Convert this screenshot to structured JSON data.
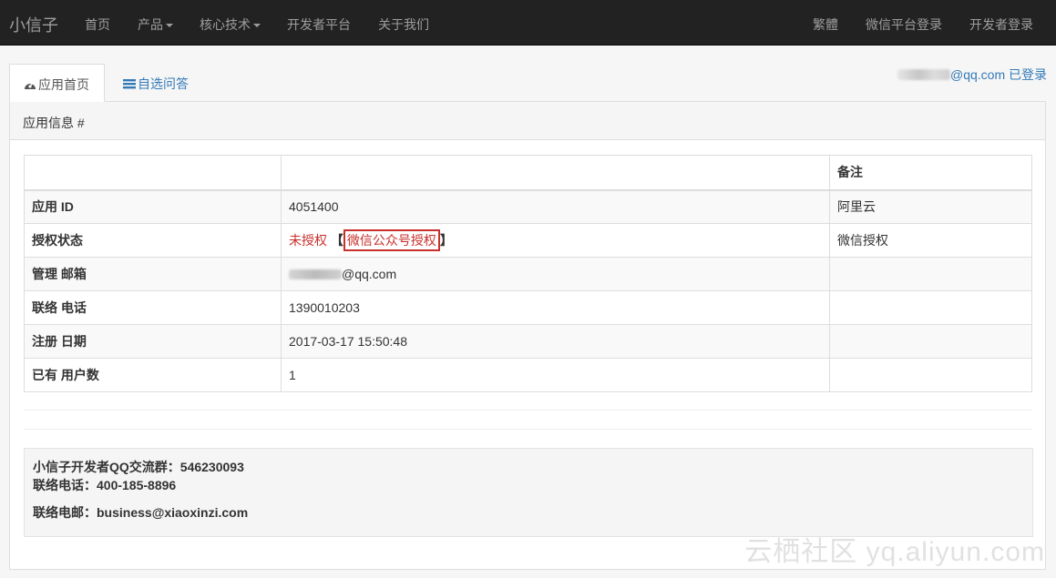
{
  "navbar": {
    "brand": "小信子",
    "items": [
      "首页",
      "产品",
      "核心技术",
      "开发者平台",
      "关于我们"
    ],
    "right_items": [
      "繁體",
      "微信平台登录",
      "开发者登录"
    ]
  },
  "tabs": [
    {
      "label": "应用首页",
      "icon": "dashboard-icon"
    },
    {
      "label": "自选问答",
      "icon": "list-icon"
    }
  ],
  "login_status": {
    "email_suffix": "@qq.com",
    "text": " 已登录"
  },
  "panel": {
    "title": "应用信息 #"
  },
  "table": {
    "header_note": "备注",
    "rows": [
      {
        "label": "应用 ID",
        "value": "4051400",
        "note": "阿里云"
      },
      {
        "label": "授权状态",
        "status": "未授权",
        "bracket_open": "【",
        "link": "微信公众号授权",
        "bracket_close": "】",
        "note": "微信授权"
      },
      {
        "label": "管理 邮箱",
        "email_suffix": "@qq.com",
        "note": ""
      },
      {
        "label": "联络 电话",
        "value": "1390010203",
        "note": ""
      },
      {
        "label": "注册 日期",
        "value": "2017-03-17 15:50:48",
        "note": ""
      },
      {
        "label": "已有 用户数",
        "value": "1",
        "note": ""
      }
    ]
  },
  "contact": {
    "qq_group": "小信子开发者QQ交流群：546230093",
    "phone": "联络电话：400-185-8896",
    "email": "联络电邮：business@xiaoxinzi.com"
  },
  "watermark": "云栖社区 yq.aliyun.com",
  "colors": {
    "navbar": "#222222",
    "link": "#337ab7",
    "danger": "#c9302c"
  }
}
